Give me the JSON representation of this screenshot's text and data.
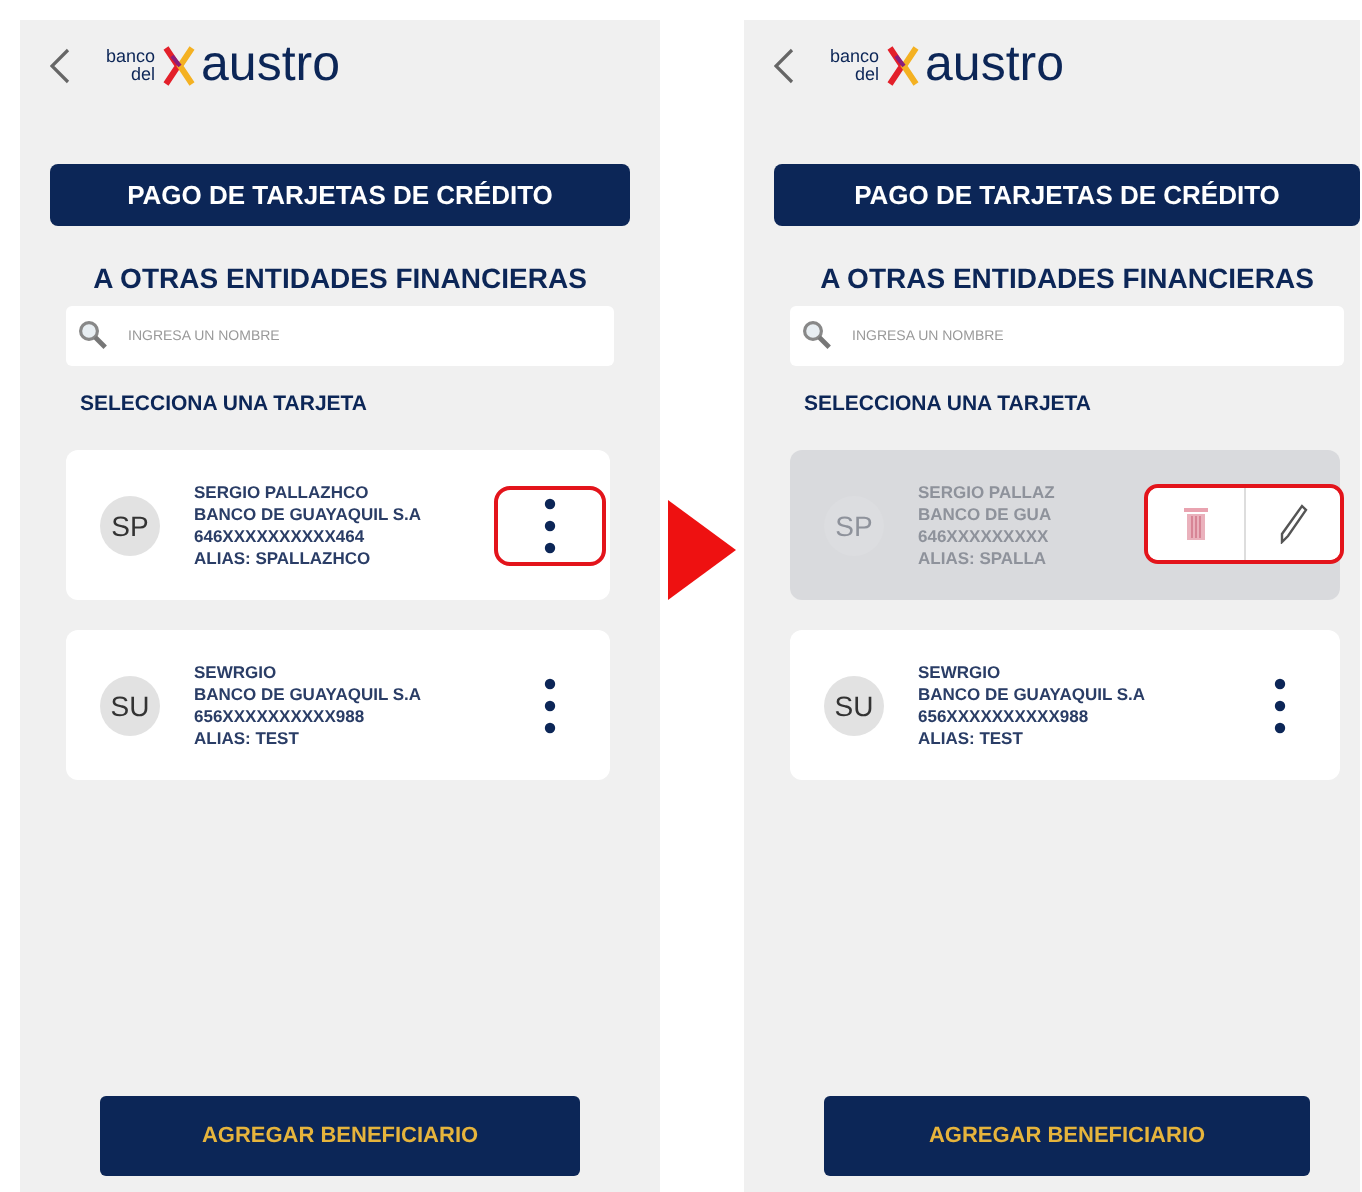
{
  "screens": [
    {
      "logo": {
        "top": "banco",
        "bottom": "del",
        "name": "austro"
      },
      "title": "PAGO DE TARJETAS DE CRÉDITO",
      "subtitle": "A OTRAS ENTIDADES FINANCIERAS",
      "search": {
        "placeholder": "INGRESA UN NOMBRE"
      },
      "section": "SELECCIONA UNA TARJETA",
      "cards": [
        {
          "initials": "SP",
          "name": "SERGIO PALLAZHCO",
          "bank": "BANCO DE GUAYAQUIL S.A",
          "number": "646XXXXXXXXXX464",
          "alias": "ALIAS: SPALLAZHCO",
          "menu_open": false,
          "highlighted": true
        },
        {
          "initials": "SU",
          "name": "SEWRGIO",
          "bank": "BANCO DE GUAYAQUIL S.A",
          "number": "656XXXXXXXXXX988",
          "alias": "ALIAS: TEST",
          "menu_open": false,
          "highlighted": false
        }
      ],
      "button": "AGREGAR BENEFICIARIO"
    },
    {
      "logo": {
        "top": "banco",
        "bottom": "del",
        "name": "austro"
      },
      "title": "PAGO DE TARJETAS DE CRÉDITO",
      "subtitle": "A OTRAS ENTIDADES FINANCIERAS",
      "search": {
        "placeholder": "INGRESA UN NOMBRE"
      },
      "section": "SELECCIONA UNA TARJETA",
      "cards": [
        {
          "initials": "SP",
          "name": "SERGIO PALLAZ",
          "bank": "BANCO DE GUA",
          "number": "646XXXXXXXXX",
          "alias": "ALIAS: SPALLA",
          "menu_open": true,
          "highlighted": true
        },
        {
          "initials": "SU",
          "name": "SEWRGIO",
          "bank": "BANCO DE GUAYAQUIL S.A",
          "number": "656XXXXXXXXXX988",
          "alias": "ALIAS: TEST",
          "menu_open": false,
          "highlighted": false
        }
      ],
      "button": "AGREGAR BENEFICIARIO"
    }
  ]
}
